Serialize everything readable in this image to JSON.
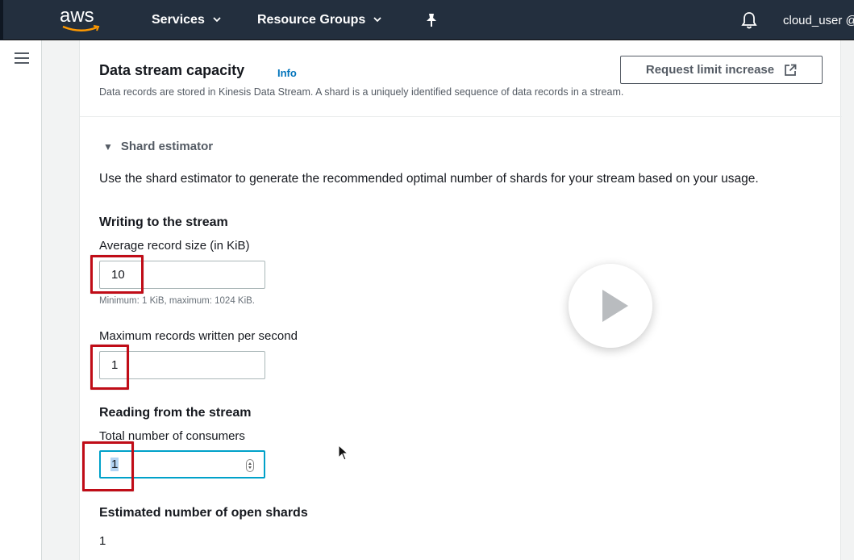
{
  "nav": {
    "logo": "aws",
    "services": "Services",
    "resource_groups": "Resource Groups",
    "user": "cloud_user @"
  },
  "header": {
    "title": "Data stream capacity",
    "info": "Info",
    "description": "Data records are stored in Kinesis Data Stream. A shard is a uniquely identified sequence of data records in a stream.",
    "request_button": "Request limit increase"
  },
  "estimator": {
    "toggle_label": "Shard estimator",
    "description": "Use the shard estimator to generate the recommended optimal number of shards for your stream based on your usage.",
    "writing": {
      "title": "Writing to the stream",
      "record_size_label": "Average record size (in KiB)",
      "record_size_value": "10",
      "record_size_hint": "Minimum: 1 KiB, maximum: 1024 KiB.",
      "max_records_label": "Maximum records written per second",
      "max_records_value": "1"
    },
    "reading": {
      "title": "Reading from the stream",
      "consumers_label": "Total number of consumers",
      "consumers_value": "1"
    },
    "result": {
      "title": "Estimated number of open shards",
      "value": "1"
    }
  },
  "colors": {
    "nav_bg": "#232f3e",
    "link": "#0073bb",
    "annotation": "#c00c17",
    "focus": "#00a1c9"
  },
  "icons": [
    "menu-icon",
    "pin-icon",
    "bell-icon",
    "external-link-icon",
    "caret-down-icon",
    "play-icon",
    "mouse-cursor-icon"
  ]
}
